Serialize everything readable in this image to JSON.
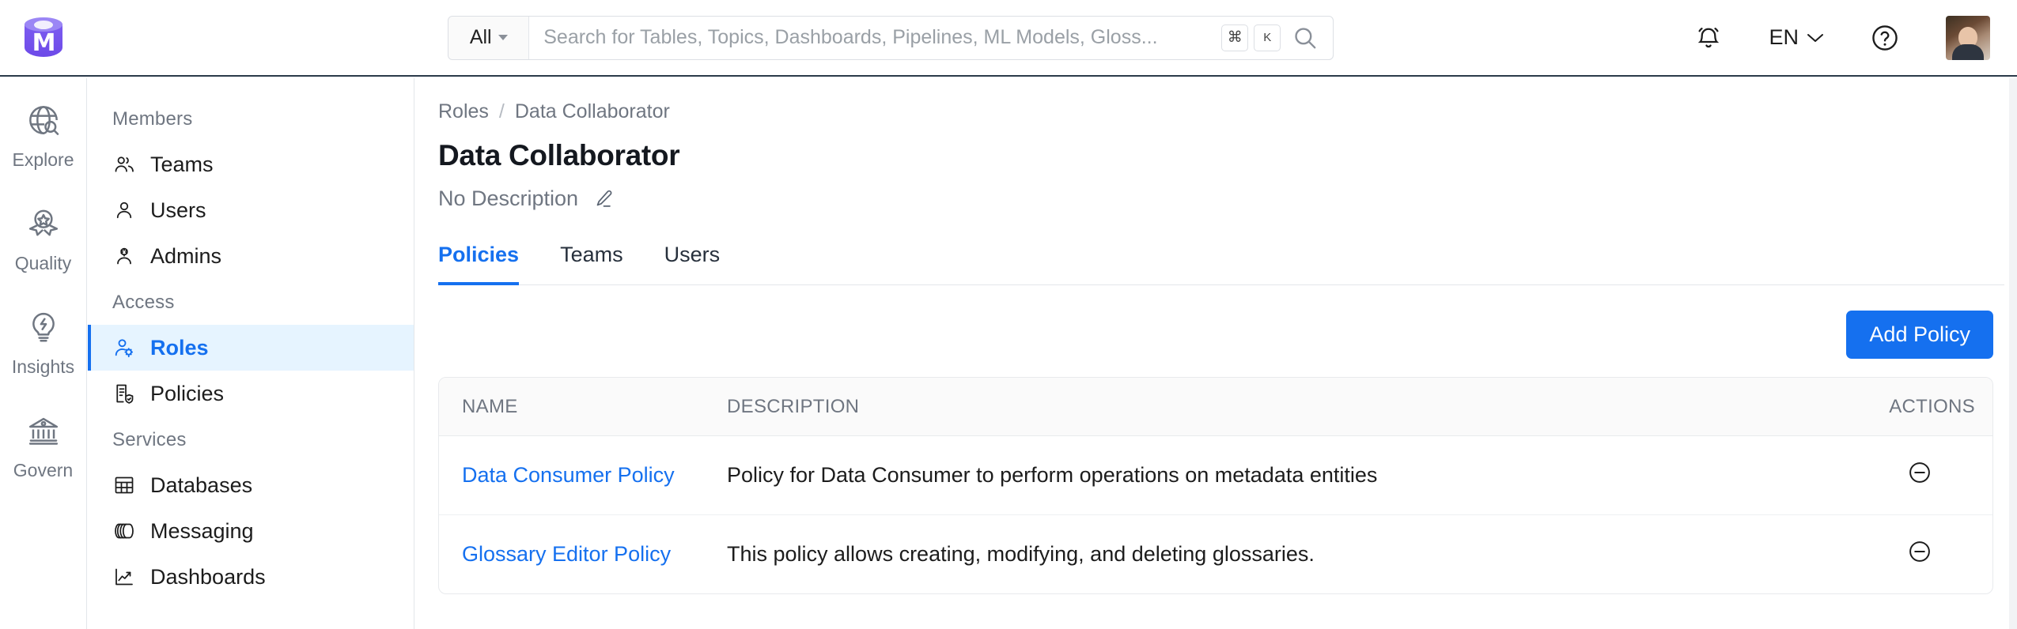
{
  "header": {
    "logo_name": "openmetadata-logo",
    "logo_letter": "M",
    "search": {
      "scope_label": "All",
      "placeholder": "Search for Tables, Topics, Dashboards, Pipelines, ML Models, Gloss...",
      "value": "",
      "shortcut_meta": "⌘",
      "shortcut_key": "K"
    },
    "language": "EN",
    "notification_icon": "bell-icon",
    "help_icon": "help-circle-icon",
    "avatar_name": "user-avatar"
  },
  "left_rail": {
    "items": [
      {
        "label": "Explore",
        "icon": "globe-search-icon"
      },
      {
        "label": "Quality",
        "icon": "award-ribbon-icon"
      },
      {
        "label": "Insights",
        "icon": "lightbulb-bolt-icon"
      },
      {
        "label": "Govern",
        "icon": "bank-icon"
      }
    ]
  },
  "sidebar": {
    "groups": [
      {
        "title": "Members",
        "items": [
          {
            "label": "Teams",
            "icon": "users-group-icon",
            "active": false
          },
          {
            "label": "Users",
            "icon": "user-icon",
            "active": false
          },
          {
            "label": "Admins",
            "icon": "user-gear-icon",
            "active": false
          }
        ]
      },
      {
        "title": "Access",
        "items": [
          {
            "label": "Roles",
            "icon": "user-cog-icon",
            "active": true
          },
          {
            "label": "Policies",
            "icon": "document-shield-icon",
            "active": false
          }
        ]
      },
      {
        "title": "Services",
        "items": [
          {
            "label": "Databases",
            "icon": "table-grid-icon",
            "active": false
          },
          {
            "label": "Messaging",
            "icon": "message-queue-icon",
            "active": false
          },
          {
            "label": "Dashboards",
            "icon": "chart-line-icon",
            "active": false
          }
        ]
      }
    ]
  },
  "main": {
    "breadcrumb": {
      "root": "Roles",
      "separator": "/",
      "current": "Data Collaborator"
    },
    "title": "Data Collaborator",
    "description": "No Description",
    "edit_icon": "pencil-icon",
    "tabs": [
      {
        "label": "Policies",
        "active": true
      },
      {
        "label": "Teams",
        "active": false
      },
      {
        "label": "Users",
        "active": false
      }
    ],
    "add_policy_label": "Add Policy",
    "table": {
      "columns": [
        "NAME",
        "DESCRIPTION",
        "ACTIONS"
      ],
      "rows": [
        {
          "name": "Data Consumer Policy",
          "description": "Policy for Data Consumer to perform operations on metadata entities",
          "action_icon": "circle-minus-icon"
        },
        {
          "name": "Glossary Editor Policy",
          "description": "This policy allows creating, modifying, and deleting glossaries.",
          "action_icon": "circle-minus-icon"
        }
      ]
    }
  },
  "colors": {
    "accent_blue": "#1570ef",
    "active_bg": "#e6f4ff",
    "brand_purple": "#7c5cf0",
    "text_muted": "#6f7681",
    "header_border": "#2b3a4a"
  }
}
